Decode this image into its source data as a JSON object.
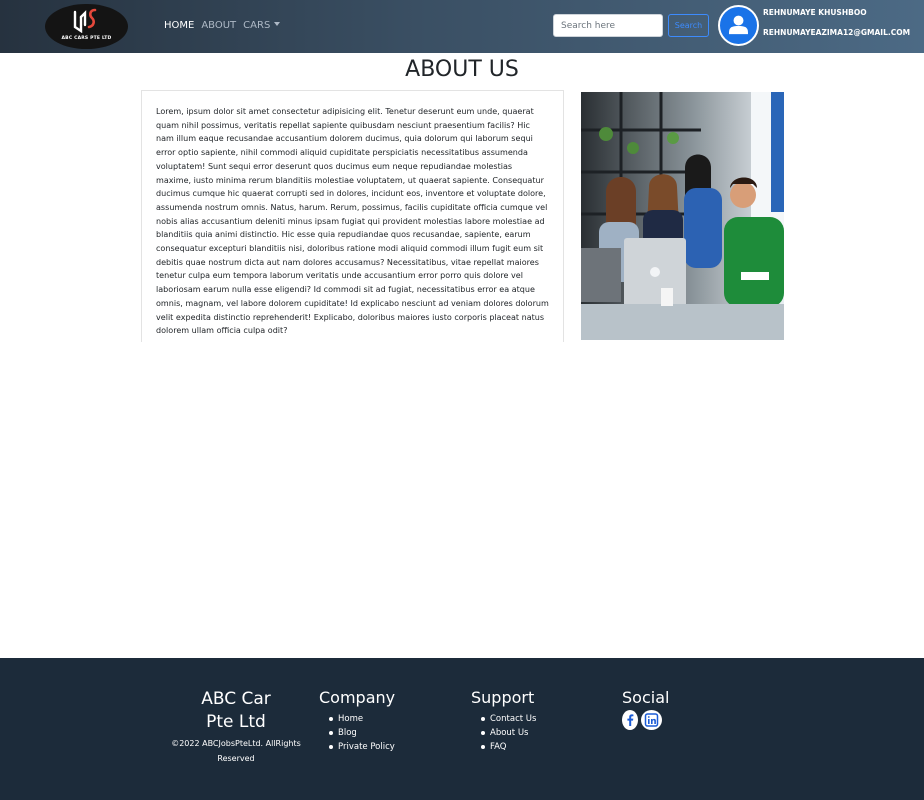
{
  "navbar": {
    "logo_text": "ABC CARS PTE LTD",
    "links": [
      {
        "label": "HOME",
        "active": true
      },
      {
        "label": "ABOUT",
        "active": false
      },
      {
        "label": "CARS",
        "active": false,
        "dropdown": true
      }
    ],
    "search": {
      "placeholder": "Search here",
      "value": "",
      "button_label": "Search"
    },
    "user": {
      "name": "REHNUMAYE KHUSHBOO",
      "email": "REHNUMAYEAZIMA12@GMAIL.COM",
      "icon": "user-avatar-icon"
    }
  },
  "main": {
    "title": "ABOUT US",
    "body": "Lorem, ipsum dolor sit amet consectetur adipisicing elit. Tenetur deserunt eum unde, quaerat quam nihil possimus, veritatis repellat sapiente quibusdam nesciunt praesentium facilis? Hic nam illum eaque recusandae accusantium dolorem ducimus, quia dolorum qui laborum sequi error optio sapiente, nihil commodi aliquid cupiditate perspiciatis necessitatibus assumenda voluptatem! Sunt sequi error deserunt quos ducimus eum neque repudiandae molestias maxime, iusto minima rerum blanditiis molestiae voluptatem, ut quaerat sapiente. Consequatur ducimus cumque hic quaerat corrupti sed in dolores, incidunt eos, inventore et voluptate dolore, assumenda nostrum omnis. Natus, harum. Rerum, possimus, facilis cupiditate officia cumque vel nobis alias accusantium deleniti minus ipsam fugiat qui provident molestias labore molestiae ad blanditiis quia animi distinctio. Hic esse quia repudiandae quos recusandae, sapiente, earum consequatur excepturi blanditiis nisi, doloribus ratione modi aliquid commodi illum fugit eum sit debitis quae nostrum dicta aut nam dolores accusamus? Necessitatibus, vitae repellat maiores tenetur culpa eum tempora laborum veritatis unde accusantium error porro quis dolore vel laboriosam earum nulla esse eligendi? Id commodi sit ad fugiat, necessitatibus error ea atque omnis, magnam, vel labore dolorem cupiditate! Id explicabo nesciunt ad veniam dolores dolorum velit expedita distinctio reprehenderit! Explicabo, doloribus maiores iusto corporis placeat natus dolorem ullam officia culpa odit?"
  },
  "footer": {
    "brand_line1": "ABC Car",
    "brand_line2": "Pte Ltd",
    "copyright": "©2022 ABCJobsPteLtd. AllRights Reserved",
    "company": {
      "title": "Company",
      "links": [
        "Home",
        "Blog",
        "Private Policy"
      ]
    },
    "support": {
      "title": "Support",
      "links": [
        "Contact Us",
        "About Us",
        "FAQ"
      ]
    },
    "social": {
      "title": "Social",
      "icons": [
        "facebook-icon",
        "linkedin-icon"
      ]
    }
  },
  "colors": {
    "navbar_start": "#26323f",
    "navbar_end": "#4c6a85",
    "accent_blue": "#3d8bfd",
    "avatar_blue": "#1a73e8",
    "footer_bg": "#1c2b3a",
    "logo_red": "#e5483b"
  }
}
